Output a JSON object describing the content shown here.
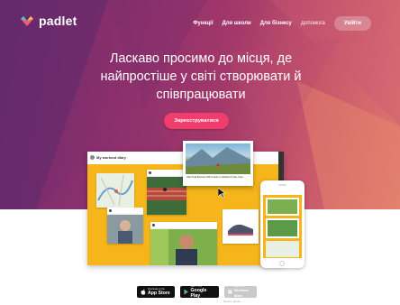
{
  "header": {
    "logo_text": "padlet",
    "nav": [
      "Функції",
      "Для школи",
      "Для бізнесу"
    ],
    "help": "Допомога",
    "login": "Увійти"
  },
  "hero": {
    "headline": "Ласкаво просимо до місця, де найпростіше у світі створювати й співпрацювати",
    "cta": "Зареєструватися"
  },
  "board": {
    "title": "My workout diary",
    "popup_caption": "Ultra Trail Runners Who Fuels on Workout Fruits. Fuel…"
  },
  "badges": {
    "app_store": {
      "small": "Download on the",
      "big": "App Store"
    },
    "google_play": {
      "small": "GET IT ON",
      "big": "Google Play"
    },
    "windows": {
      "small": "Get it from",
      "big": "Windows Store"
    },
    "footnote": "Просто ярлик"
  },
  "colors": {
    "cta": "#f03d6e",
    "board": "#f6b51a",
    "hero_start": "#6a2a6e",
    "hero_end": "#e0796f"
  }
}
